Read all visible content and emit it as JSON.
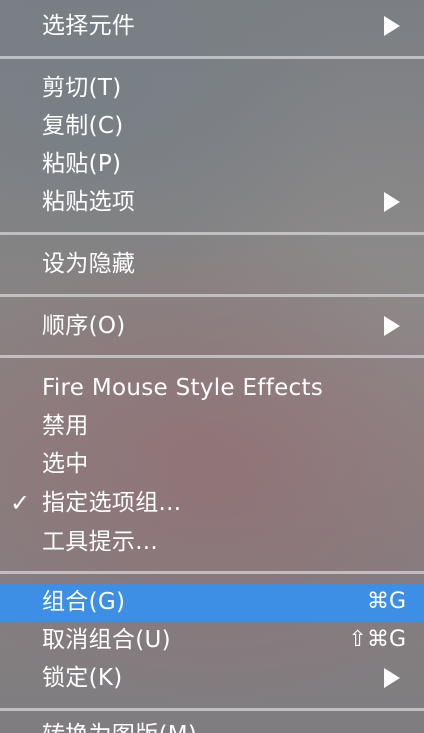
{
  "context_menu": {
    "items": [
      {
        "label": "选择元件",
        "submenu": true
      },
      {
        "label": "剪切(T)"
      },
      {
        "label": "复制(C)"
      },
      {
        "label": "粘贴(P)"
      },
      {
        "label": "粘贴选项",
        "submenu": true
      },
      {
        "label": "设为隐藏"
      },
      {
        "label": "顺序(O)",
        "submenu": true
      },
      {
        "label": "Fire Mouse Style Effects"
      },
      {
        "label": "禁用"
      },
      {
        "label": "选中"
      },
      {
        "label": "指定选项组...",
        "checked": true,
        "check_mark": "✓"
      },
      {
        "label": "工具提示..."
      },
      {
        "label": "组合(G)",
        "shortcut": "⌘G",
        "highlighted": true
      },
      {
        "label": "取消组合(U)",
        "shortcut": "⇧⌘G"
      },
      {
        "label": "锁定(K)",
        "submenu": true
      },
      {
        "label": "转换为图版(M)"
      }
    ],
    "colors": {
      "highlight": "#3d8fe6",
      "text": "#ffffff",
      "separator": "#d7d7da"
    },
    "icons": {
      "submenu": "triangle-right-icon",
      "check": "checkmark-icon"
    }
  }
}
